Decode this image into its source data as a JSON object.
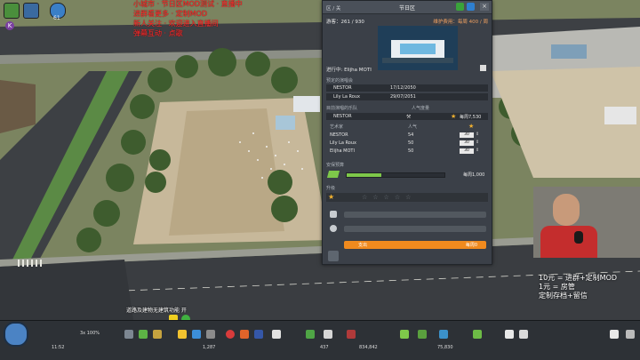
{
  "overlay": {
    "lines": [
      "小城市 · 节日区MOD测试 · 直播中",
      "进群看更多 · 定制MOD",
      "新人关注 · 欢迎进入直播间",
      "弹幕互动 · 点歌"
    ],
    "top_left_number": "61",
    "bottom_hint": "道路及建物无建筑功能 开",
    "right_text_1": "10元 = 进群+定制MOD",
    "right_text_2": "1元 = 房管",
    "right_text_3": "定制存档+留信"
  },
  "panel": {
    "title": "节日区",
    "breadcrumb": "区 / 关",
    "visitors_label": "游客：261 / 930",
    "maintenance_label": "维护费用：每周 400 / 周",
    "now_playing_label": "进行中: Elijha MOTI",
    "upcoming_title": "预定的演唱会",
    "schedule": [
      {
        "name": "NESTOR",
        "date": "17/12/2050"
      },
      {
        "name": "Lily La Roux",
        "date": "29/07/2051"
      }
    ],
    "band_section_title": "目前演唱的乐队",
    "band_popularity_label": "人气度量",
    "current_band": {
      "name": "NESTOR",
      "cost": "每周7,530"
    },
    "artists_header": {
      "artist": "艺术家",
      "popularity": "人气"
    },
    "artists": [
      {
        "name": "NESTOR",
        "popularity": "54",
        "fee": "30"
      },
      {
        "name": "Lily La Roux",
        "popularity": "50",
        "fee": "30"
      },
      {
        "name": "Elijha MOTI",
        "popularity": "50",
        "fee": "30"
      }
    ],
    "security_title": "安保预算",
    "security_cost": "每周1,000",
    "security_fraction": 0.35,
    "upgrade_title": "升级",
    "stars_total": 5,
    "stars_filled": 0,
    "pay_label": "支出",
    "pay_value": "每周0"
  },
  "bottom": {
    "speed": "3x  100%",
    "date": "11:52",
    "money": "834,842",
    "population": "75,830",
    "stat_a": "437",
    "stat_b": "1,287"
  },
  "colors": {
    "accent_green": "#7ec84a",
    "orange": "#f08a1e",
    "panel_bg": "#3b4048"
  }
}
